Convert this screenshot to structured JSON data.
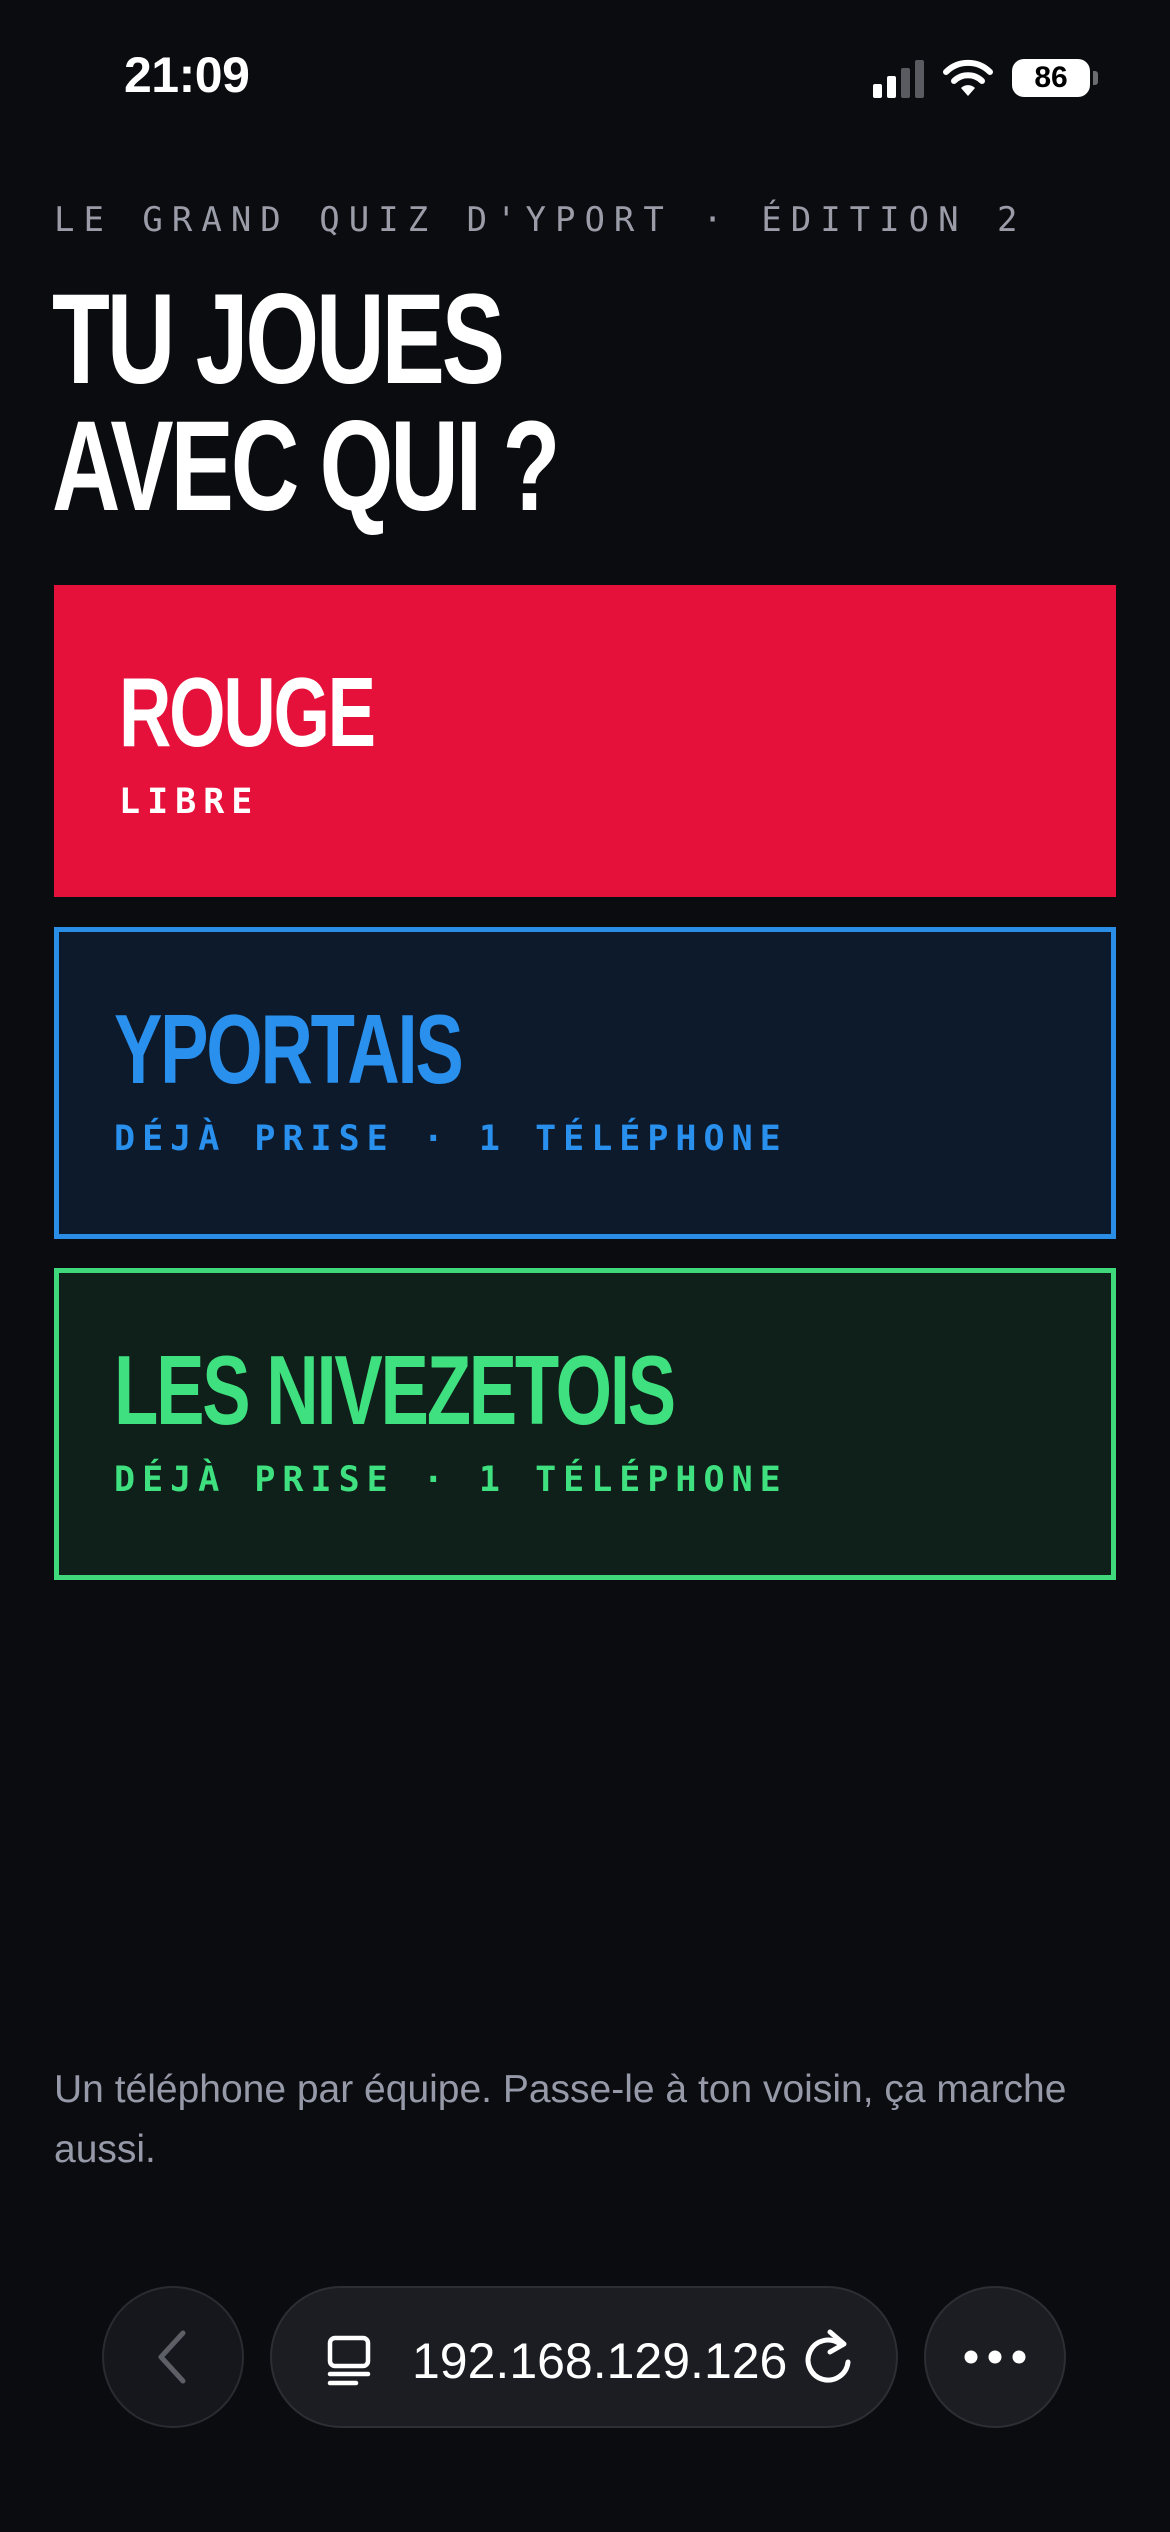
{
  "status_bar": {
    "time": "21:09",
    "battery": "86",
    "signal_bars_active": 2,
    "signal_bars_total": 4
  },
  "header": {
    "kicker": "LE GRAND QUIZ D'YPORT · ÉDITION 2",
    "title": "TU JOUES\nAVEC QUI ?"
  },
  "teams": [
    {
      "name": "ROUGE",
      "status": "LIBRE",
      "available": true,
      "fill": "#e5113b",
      "border": "#e5113b",
      "text_color": "#ffffff"
    },
    {
      "name": "YPORTAIS",
      "status": "DÉJÀ PRISE · 1 TÉLÉPHONE",
      "available": false,
      "fill": "#0c1a2c",
      "border": "#2a8de6",
      "text_color": "#2a90ee"
    },
    {
      "name": "LES NIVEZETOIS",
      "status": "DÉJÀ PRISE · 1 TÉLÉPHONE",
      "available": false,
      "fill": "#0f1f1a",
      "border": "#3fd97c",
      "text_color": "#3fe07f"
    }
  ],
  "footer": {
    "note": "Un téléphone par équipe. Passe-le à ton voisin, ça marche aussi."
  },
  "browser": {
    "url": "192.168.129.126",
    "back_icon": "chevron-left-icon",
    "page_icon": "page-menu-icon",
    "reload_icon": "reload-icon",
    "more_icon": "more-icon"
  },
  "colors": {
    "background": "#0b0c10",
    "muted_text": "#9a9ca8"
  }
}
